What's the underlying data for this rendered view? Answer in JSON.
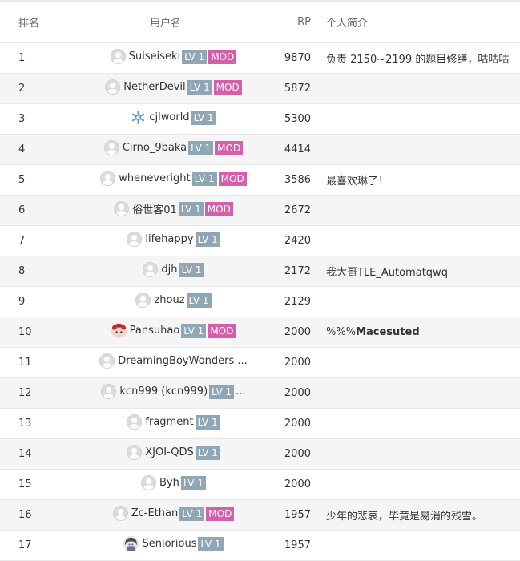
{
  "columns": {
    "rank": "排名",
    "user": "用户名",
    "rp": "RP",
    "intro": "个人简介"
  },
  "rows": [
    {
      "rank": "1",
      "user": "Suiseiseki",
      "lv": "LV 1",
      "mod": "MOD",
      "rp": "9870",
      "intro": "负责 2150~2199 的题目修缮，咕咕咕",
      "avatar": "default"
    },
    {
      "rank": "2",
      "user": "NetherDevil",
      "lv": "LV 1",
      "mod": "MOD",
      "rp": "5872",
      "intro": "",
      "avatar": "default"
    },
    {
      "rank": "3",
      "user": "cjlworld",
      "lv": "LV 1",
      "mod": "",
      "rp": "5300",
      "intro": "",
      "avatar": "snowflake"
    },
    {
      "rank": "4",
      "user": "Cirno_9baka",
      "lv": "LV 1",
      "mod": "MOD",
      "rp": "4414",
      "intro": "",
      "avatar": "default"
    },
    {
      "rank": "5",
      "user": "wheneveright",
      "lv": "LV 1",
      "mod": "MOD",
      "rp": "3586",
      "intro": "最喜欢琳了！",
      "avatar": "default"
    },
    {
      "rank": "6",
      "user": "俗世客01",
      "lv": "LV 1",
      "mod": "MOD",
      "rp": "2672",
      "intro": "",
      "avatar": "default"
    },
    {
      "rank": "7",
      "user": "lifehappy",
      "lv": "LV 1",
      "mod": "",
      "rp": "2420",
      "intro": "",
      "avatar": "default"
    },
    {
      "rank": "8",
      "user": "djh",
      "lv": "LV 1",
      "mod": "",
      "rp": "2172",
      "intro": "我大哥TLE_Automatqwq",
      "avatar": "default"
    },
    {
      "rank": "9",
      "user": "zhouz",
      "lv": "LV 1",
      "mod": "",
      "rp": "2129",
      "intro": "",
      "avatar": "default"
    },
    {
      "rank": "10",
      "user": "Pansuhao",
      "lv": "LV 1",
      "mod": "MOD",
      "rp": "2000",
      "intro_prefix": "%%%",
      "intro_bold": "Macesuted",
      "avatar": "anime-red"
    },
    {
      "rank": "11",
      "user": "DreamingBoyWonders ...",
      "lv": "",
      "mod": "",
      "rp": "2000",
      "intro": "",
      "avatar": "default"
    },
    {
      "rank": "12",
      "user": "kcn999 (kcn999)",
      "lv": "LV 1",
      "mod": "",
      "trunc": "...",
      "rp": "2000",
      "intro": "",
      "avatar": "default"
    },
    {
      "rank": "13",
      "user": "fragment",
      "lv": "LV 1",
      "mod": "",
      "rp": "2000",
      "intro": "",
      "avatar": "default"
    },
    {
      "rank": "14",
      "user": "XJOI-QDS",
      "lv": "LV 1",
      "mod": "",
      "rp": "2000",
      "intro": "",
      "avatar": "default"
    },
    {
      "rank": "15",
      "user": "Byh",
      "lv": "LV 1",
      "mod": "",
      "rp": "2000",
      "intro": "",
      "avatar": "default"
    },
    {
      "rank": "16",
      "user": "Zc-Ethan",
      "lv": "LV 1",
      "mod": "MOD",
      "rp": "1957",
      "intro": "少年的悲哀，毕竟是易消的残雪。",
      "avatar": "default"
    },
    {
      "rank": "17",
      "user": "Seniorious",
      "lv": "LV 1",
      "mod": "",
      "rp": "1957",
      "intro": "",
      "avatar": "anime-grey"
    }
  ],
  "colors": {
    "lv_badge": "#8fa6b6",
    "mod_badge": "#d55fa8",
    "row_alt": "#f5f5f5"
  }
}
